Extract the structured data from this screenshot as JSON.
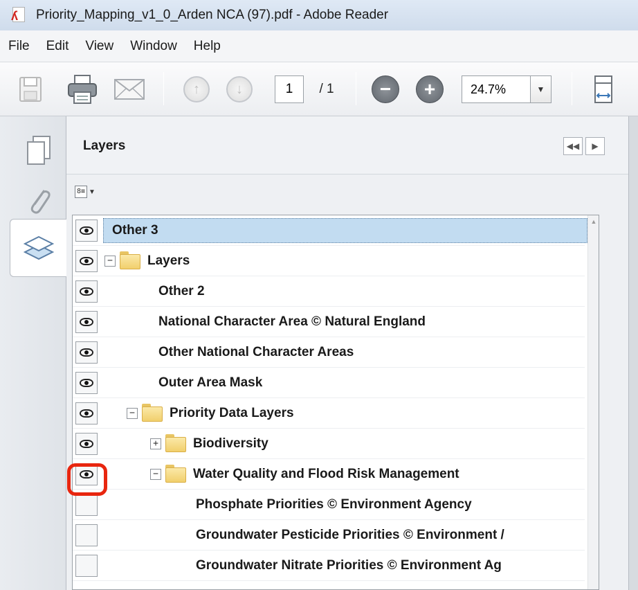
{
  "window": {
    "title": "Priority_Mapping_v1_0_Arden NCA (97).pdf - Adobe Reader"
  },
  "menu": [
    "File",
    "Edit",
    "View",
    "Window",
    "Help"
  ],
  "toolbar": {
    "page_current": "1",
    "page_total": "/ 1",
    "zoom_value": "24.7%",
    "icons": [
      "save-icon",
      "print-icon",
      "email-icon",
      "previous-page-icon",
      "next-page-icon",
      "zoom-out-icon",
      "zoom-in-icon",
      "fit-page-icon"
    ]
  },
  "nav_tabs": [
    "pages-icon",
    "attachments-icon",
    "layers-icon"
  ],
  "panel": {
    "title": "Layers",
    "layers": [
      {
        "label": "Other 3",
        "visible": true,
        "selected": true
      },
      {
        "label": "Layers",
        "visible": true,
        "folder": true,
        "expander": "−"
      },
      {
        "label": "Other 2",
        "visible": true
      },
      {
        "label": "National Character Area © Natural England",
        "visible": true
      },
      {
        "label": "Other National Character Areas",
        "visible": true
      },
      {
        "label": "Outer Area Mask",
        "visible": true
      },
      {
        "label": "Priority Data Layers",
        "visible": true,
        "folder": true,
        "expander": "−"
      },
      {
        "label": "Biodiversity",
        "visible": true,
        "folder": true,
        "expander": "+"
      },
      {
        "label": "Water Quality and Flood Risk Management",
        "visible": true,
        "folder": true,
        "expander": "−",
        "highlighted": true
      },
      {
        "label": "Phosphate Priorities © Environment Agency",
        "visible": false
      },
      {
        "label": "Groundwater Pesticide Priorities © Environment /",
        "visible": false
      },
      {
        "label": "Groundwater Nitrate Priorities © Environment Ag",
        "visible": false
      }
    ]
  },
  "colors": {
    "highlight_ring": "#e8260f",
    "selection": "#c2dcf1",
    "folder": "#f1cf6c"
  }
}
